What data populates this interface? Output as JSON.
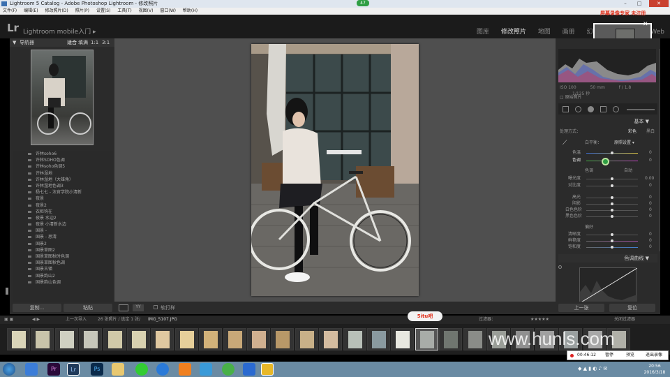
{
  "window": {
    "title": "Lightroom 5 Catalog - Adobe Photoshop Lightroom - 修改照片",
    "record_badge": "47",
    "overlay_text": "屏幕录像专家 未注册"
  },
  "menu": [
    "文件(F)",
    "编辑(E)",
    "修改照片(D)",
    "照片(P)",
    "设置(S)",
    "工具(T)",
    "视图(V)",
    "窗口(W)",
    "帮助(H)"
  ],
  "topbar": {
    "logo": "Lr",
    "mobile_label": "Lightroom mobile入门",
    "modules": [
      "图库",
      "修改照片",
      "地图",
      "画册",
      "幻",
      "Web"
    ],
    "active_module": "修改照片"
  },
  "navigator": {
    "title": "导航器",
    "zoom_options": [
      "适合",
      "填满",
      "1:1",
      "3:1"
    ]
  },
  "presets": [
    "许林soho6",
    "许林SOHO色调",
    "许林soho色调5",
    "许林湿地",
    "许林湿地（大雄角）",
    "许林湿地色调3",
    "杨七七 - 法官学院小清新",
    "夜景",
    "夜景2",
    "衣柜钩在",
    "夜景 水边2",
    "夜景 小清新水边",
    "国景 -",
    "国景 - 思清",
    "国景2",
    "国景草图2",
    "国景草图秋时色调",
    "国景草图秋色调",
    "国景古镇",
    "国景韵山2",
    "国景韵山色调"
  ],
  "left_buttons": {
    "copy": "复制...",
    "paste": "粘贴"
  },
  "right_panel": {
    "hist_meta": [
      "ISO 100",
      "50 mm",
      "f / 1.8",
      "1/125 秒"
    ],
    "original_label": "原始照片",
    "basic_title": "基本",
    "treatment_label": "处理方式：",
    "treatment_color": "彩色",
    "treatment_bw": "黑白",
    "wb_label": "白平衡：",
    "wb_value": "原照设置",
    "temp": {
      "label": "色温",
      "value": "0"
    },
    "tint": {
      "label": "色调",
      "value": "0"
    },
    "tone_label": "色调",
    "tone_auto": "自动",
    "tone_sliders": [
      {
        "label": "曝光度",
        "value": "0.00"
      },
      {
        "label": "对比度",
        "value": "0"
      },
      {
        "label": "高光",
        "value": "0"
      },
      {
        "label": "阴影",
        "value": "0"
      },
      {
        "label": "白色色阶",
        "value": "0"
      },
      {
        "label": "黑色色阶",
        "value": "0"
      }
    ],
    "presence_label": "偏好",
    "presence_sliders": [
      {
        "label": "清晰度",
        "value": "0"
      },
      {
        "label": "鲜艳度",
        "value": "0"
      },
      {
        "label": "饱和度",
        "value": "0"
      }
    ],
    "curve_title": "色调曲线"
  },
  "right_buttons": {
    "previous": "上一张",
    "reset": "复位"
  },
  "canvas_toolbar": {
    "softproof": "软打样"
  },
  "filmbar": {
    "source": "上一次导入",
    "count": "26 张照片 / 选定 1 张/",
    "filename": "IMG_5107.JPG",
    "filter_label": "过滤器：",
    "filter_value": "关闭过滤器"
  },
  "filmstrip_colors": [
    "#d9d4b8",
    "#c9c4aa",
    "#cfd0c2",
    "#c6c6ba",
    "#d0c9a8",
    "#d8d1b0",
    "#e0c8a0",
    "#e6cf9a",
    "#d2b27a",
    "#c8a878",
    "#d0b090",
    "#b89868",
    "#c8b088",
    "#d4bca0",
    "#b8c0b8",
    "#8a9aa0",
    "#e8e8e0",
    "#a8aca8",
    "#707670",
    "#8a8c88",
    "#9a9e98",
    "#909090",
    "#a0a0a0",
    "#9aa0a0",
    "#a8a8a8",
    "#b0b0a8"
  ],
  "site_badge": "5itu吧",
  "watermark": "www.hunls.com",
  "recorder": {
    "time": "00:46:12",
    "pause": "暂停",
    "show": "预览",
    "exit": "退出录像"
  },
  "clock": {
    "time": "20:56",
    "date": "2016/3/18"
  },
  "colors": {
    "accent_record": "#e0321e",
    "lr_bg": "#2b2b2b",
    "canvas": "#4f4f4f"
  }
}
